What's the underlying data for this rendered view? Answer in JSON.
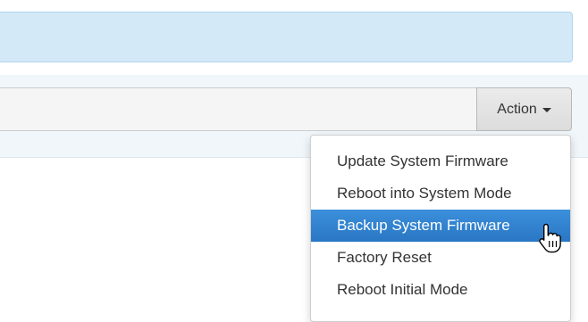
{
  "toolbar": {
    "action_label": "Action"
  },
  "dropdown": {
    "items": [
      {
        "label": "Update System Firmware",
        "active": false
      },
      {
        "label": "Reboot into System Mode",
        "active": false
      },
      {
        "label": "Backup System Firmware",
        "active": true
      },
      {
        "label": "Factory Reset",
        "active": false
      },
      {
        "label": "Reboot Initial Mode",
        "active": false
      }
    ]
  },
  "colors": {
    "alert_bg": "#d4e9f7",
    "active_item": "#2f80d0"
  },
  "icons": {
    "caret": "caret-down-icon",
    "cursor": "hand-pointer-icon"
  }
}
